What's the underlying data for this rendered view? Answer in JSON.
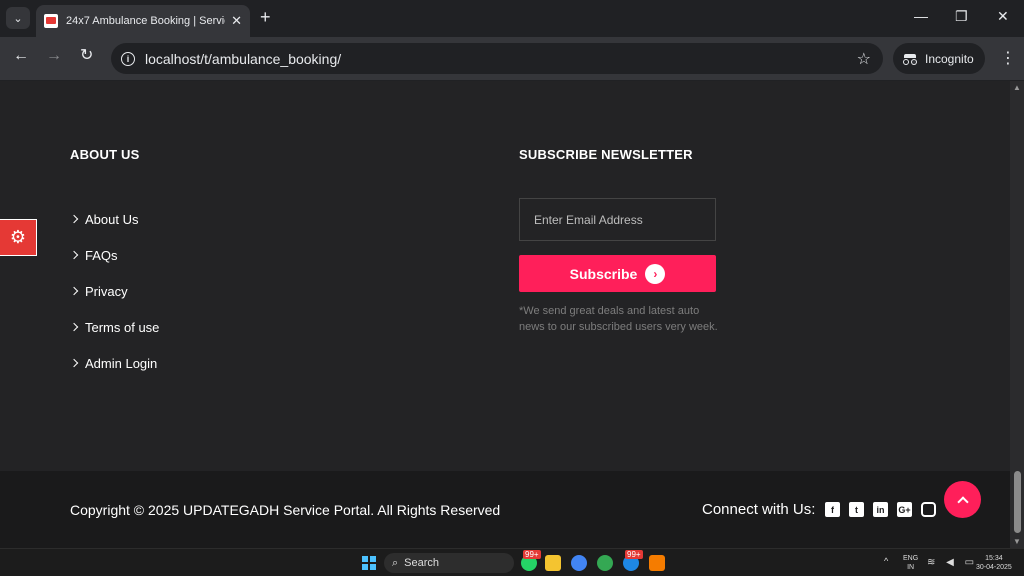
{
  "browser": {
    "tab_title": "24x7 Ambulance Booking | Service",
    "url": "localhost/t/ambulance_booking/",
    "incognito_label": "Incognito"
  },
  "footer": {
    "about_title": "ABOUT US",
    "links": [
      "About Us",
      "FAQs",
      "Privacy",
      "Terms of use",
      "Admin Login"
    ],
    "newsletter_title": "SUBSCRIBE NEWSLETTER",
    "email_placeholder": "Enter Email Address",
    "subscribe_label": "Subscribe",
    "note": "*We send great deals and latest auto news to our subscribed users very week.",
    "copyright": "Copyright © 2025 UPDATEGADH Service Portal. All Rights Reserved",
    "connect_label": "Connect with Us:",
    "social_icons": [
      "facebook-icon",
      "twitter-icon",
      "linkedin-icon",
      "google-plus-icon",
      "instagram-icon"
    ]
  },
  "taskbar": {
    "search_label": "Search",
    "badge1": "99+",
    "badge2": "99+",
    "lang_top": "ENG",
    "lang_bottom": "IN",
    "time": "15:34",
    "date": "30-04-2025"
  },
  "colors": {
    "accent": "#ff1f5a",
    "settings_tab": "#e53935",
    "footer_bg": "#232325",
    "footer_bottom_bg": "#1a1a1b"
  }
}
